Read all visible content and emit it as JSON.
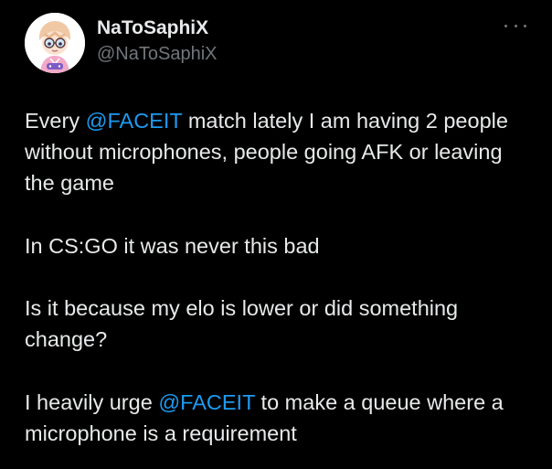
{
  "author": {
    "display_name": "NaToSaphiX",
    "handle": "@NaToSaphiX",
    "avatar_icon": "anime-avatar-icon"
  },
  "menu": {
    "more_icon": "more-options-icon"
  },
  "colors": {
    "background": "#000000",
    "text": "#e7e9ea",
    "secondary": "#71767b",
    "mention": "#1d9bf0"
  },
  "tweet": {
    "p1": {
      "before": "Every ",
      "mention": "@FACEIT",
      "after": " match lately I am having 2 people without microphones, people going AFK or leaving the game"
    },
    "p2": "In CS:GO it was never this bad",
    "p3": "Is it because my elo is lower or did something change?",
    "p4": {
      "before": "I heavily urge ",
      "mention": "@FACEIT",
      "after": " to make a queue where a microphone is a requirement"
    }
  }
}
